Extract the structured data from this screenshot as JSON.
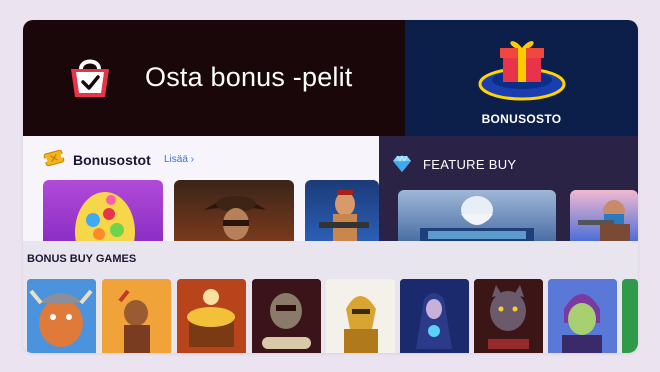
{
  "hero": {
    "title": "Osta bonus -pelit",
    "icon": "shopping-bag-check-icon"
  },
  "bonusosto": {
    "label": "BONUSOSTO",
    "icon": "gift-icon"
  },
  "bonusostot": {
    "title": "Bonusostot",
    "link": "Lisää",
    "icon": "ticket-icon"
  },
  "feature_buy": {
    "label": "FEATURE BUY",
    "icon": "diamond-icon"
  },
  "bonus_buy_games": {
    "title": "BONUS BUY GAMES"
  },
  "colors": {
    "hero_bg": "#1a0709",
    "bonusosto_bg": "#0c1f4a",
    "feature_bg": "#2b2346",
    "accent_link": "#3b6fd8"
  }
}
